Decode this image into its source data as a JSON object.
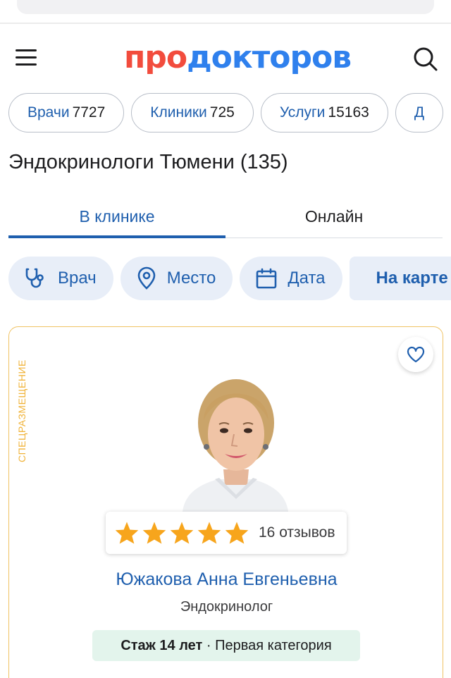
{
  "header": {
    "logo_part1": "про",
    "logo_part2": "докторов"
  },
  "categories": [
    {
      "label": "Врачи",
      "count": "7727"
    },
    {
      "label": "Клиники",
      "count": "725"
    },
    {
      "label": "Услуги",
      "count": "15163"
    },
    {
      "label": "Д",
      "count": ""
    }
  ],
  "page_title": "Эндокринологи Тюмени (135)",
  "tabs": {
    "active": "В клинике",
    "inactive": "Онлайн"
  },
  "filters": {
    "doctor": "Врач",
    "place": "Место",
    "date": "Дата",
    "map": "На карте"
  },
  "card": {
    "ad_label": "СПЕЦРАЗМЕЩЕНИЕ",
    "rating_stars": 5,
    "reviews": "16 отзывов",
    "name": "Южакова Анна Евгеньевна",
    "specialty": "Эндокринолог",
    "experience": "Стаж 14 лет",
    "category": "Первая категория"
  },
  "colors": {
    "brand_red": "#f24c3d",
    "brand_blue": "#2f80ed",
    "link_blue": "#1f5fae",
    "star": "#f7a51c",
    "ad_border": "#f0c364"
  }
}
